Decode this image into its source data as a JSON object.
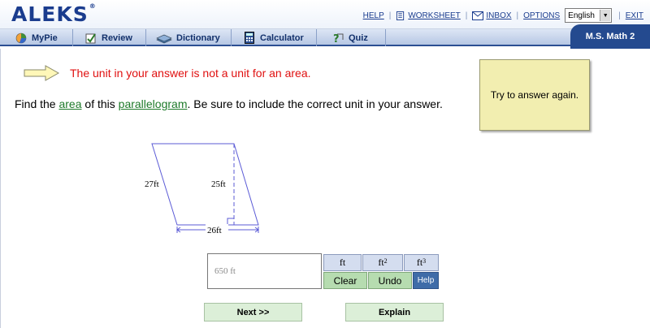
{
  "header": {
    "logo": "ALEKS",
    "logo_mark": "®",
    "links": {
      "help": "HELP",
      "worksheet": "WORKSHEET",
      "inbox": "INBOX",
      "options": "OPTIONS",
      "exit": "EXIT"
    },
    "language": "English"
  },
  "nav": {
    "tabs": [
      {
        "label": "MyPie",
        "icon": "pie-chart-icon"
      },
      {
        "label": "Review",
        "icon": "checklist-icon"
      },
      {
        "label": "Dictionary",
        "icon": "book-icon"
      },
      {
        "label": "Calculator",
        "icon": "calculator-icon"
      },
      {
        "label": "Quiz",
        "icon": "quiz-icon"
      }
    ],
    "class_name": "M.S. Math 2"
  },
  "feedback": {
    "message": "The unit in your answer is not a unit for an area."
  },
  "question": {
    "prefix": "Find the ",
    "link1": "area",
    "middle": " of this ",
    "link2": "parallelogram",
    "suffix": ". Be sure to include the correct unit in your answer."
  },
  "hint": "Try to answer again.",
  "figure": {
    "side": "27ft",
    "height": "25ft",
    "base": "26ft"
  },
  "answer": {
    "value": "650 ft"
  },
  "units": {
    "u1": "ft",
    "u2": "ft",
    "u2_exp": "2",
    "u3": "ft",
    "u3_exp": "3"
  },
  "actions": {
    "clear": "Clear",
    "undo": "Undo",
    "help": "Help"
  },
  "buttons": {
    "next": "Next >>",
    "explain": "Explain"
  },
  "colors": {
    "brand": "#1a3c8e",
    "error": "#e01010",
    "link": "#1e7a2a",
    "figure_line": "#5b5bd6"
  }
}
